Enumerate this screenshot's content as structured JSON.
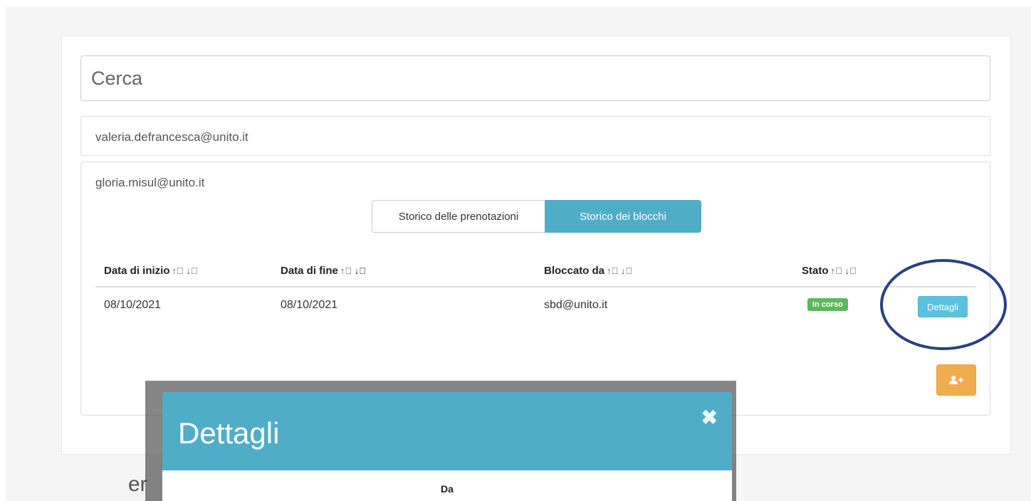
{
  "search": {
    "placeholder": "Cerca"
  },
  "users": [
    {
      "email": "valeria.defrancesca@unito.it"
    },
    {
      "email": "gloria.misul@unito.it"
    }
  ],
  "tabs": [
    {
      "label": "Storico delle prenotazioni",
      "active": false
    },
    {
      "label": "Storico dei blocchi",
      "active": true
    }
  ],
  "table": {
    "headers": [
      "Data di inizio",
      "Data di fine",
      "Bloccato da",
      "Stato"
    ],
    "sort_icons": "⓪ ⓪",
    "rows": [
      {
        "start": "08/10/2021",
        "end": "08/10/2021",
        "blocked_by": "sbd@unito.it",
        "status": "In corso",
        "action": "Dettagli"
      }
    ]
  },
  "add_button": {
    "icon": "add-user-icon"
  },
  "behind_fragment": "er",
  "modal": {
    "title": "Dettagli",
    "close_glyph": "✖",
    "field_label": "Da"
  },
  "colors": {
    "accent": "#4fadc8",
    "info_button": "#5bc0de",
    "success": "#5cb85c",
    "warning": "#f0ad4e",
    "highlight_ring": "#2a3f82"
  }
}
